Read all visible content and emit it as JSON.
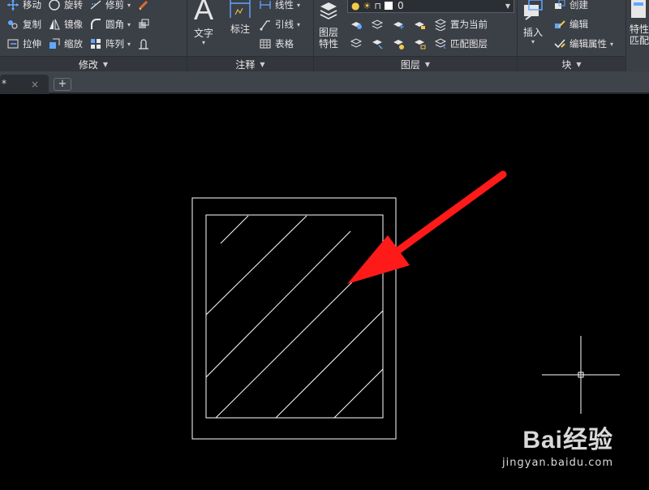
{
  "ribbon": {
    "modify": {
      "title": "修改",
      "tools": {
        "move": "移动",
        "rotate": "旋转",
        "trim": "修剪",
        "copy": "复制",
        "mirror": "镜像",
        "fillet": "圆角",
        "stretch": "拉伸",
        "scale": "缩放",
        "array": "阵列"
      }
    },
    "annotation": {
      "title": "注释",
      "text": "文字",
      "dimension": "标注",
      "linear": "线性",
      "leader": "引线",
      "table": "表格"
    },
    "layers": {
      "title": "图层",
      "properties_line1": "图层",
      "properties_line2": "特性",
      "current_layer": "0",
      "set_current": "置为当前",
      "match_layer": "匹配图层"
    },
    "block": {
      "title": "块",
      "insert": "插入",
      "create": "创建",
      "edit": "编辑",
      "edit_attributes": "编辑属性"
    },
    "properties": {
      "line1": "特性",
      "line2": "匹配"
    }
  },
  "tabs": {
    "active_label": "*",
    "close_glyph": "×",
    "add_glyph": "+"
  },
  "watermark": {
    "brand": "Bai经验",
    "url": "jingyan.baidu.com"
  },
  "colors": {
    "ribbon_bg": "#3b3f46",
    "canvas_bg": "#000000",
    "drawing_lines": "#ffffff",
    "arrow": "#ff1a1a",
    "dropdown_accent": "#f2c94c"
  },
  "icons": [
    "move-icon",
    "rotate-icon",
    "trim-icon",
    "copy-icon",
    "mirror-icon",
    "fillet-icon",
    "stretch-icon",
    "scale-icon",
    "array-icon",
    "text-icon",
    "dimension-icon",
    "linear-icon",
    "leader-icon",
    "table-icon",
    "layer-properties-icon",
    "insert-icon",
    "create-block-icon",
    "edit-block-icon",
    "edit-attributes-icon",
    "crosshair-cursor"
  ]
}
